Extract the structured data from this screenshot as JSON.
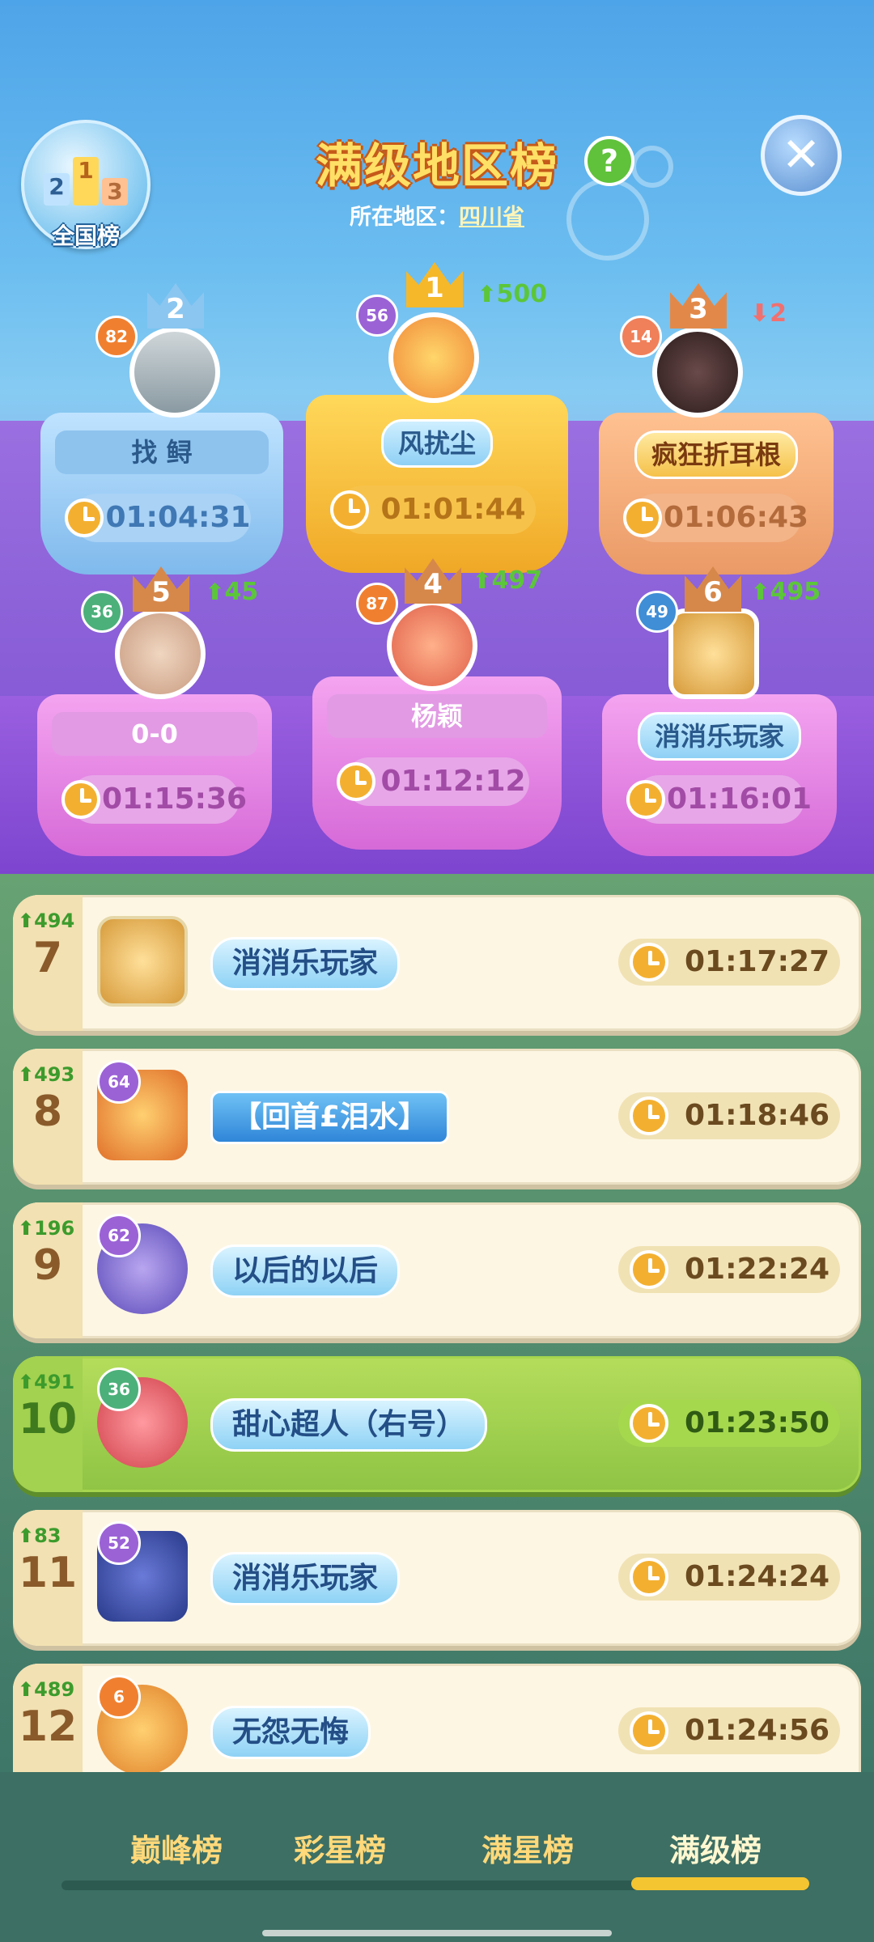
{
  "header": {
    "title": "满级地区榜",
    "national_label": "全国榜",
    "national_bars": [
      "2",
      "1",
      "3"
    ],
    "help_icon": "?",
    "close_icon": "✕",
    "region_label": "所在地区：",
    "region_value": "四川省"
  },
  "podium": [
    {
      "rank": "1",
      "level": "56",
      "change": "500",
      "name": "风扰尘",
      "time": "01:01:44"
    },
    {
      "rank": "2",
      "level": "82",
      "change": "",
      "name": "找 鲟",
      "time": "01:04:31"
    },
    {
      "rank": "3",
      "level": "14",
      "change": "2",
      "name": "疯狂折耳根",
      "time": "01:06:43"
    },
    {
      "rank": "5",
      "level": "36",
      "change": "45",
      "name": "0-0",
      "time": "01:15:36"
    },
    {
      "rank": "4",
      "level": "87",
      "change": "497",
      "name": "杨颖",
      "time": "01:12:12"
    },
    {
      "rank": "6",
      "level": "49",
      "change": "495",
      "name": "消消乐玩家",
      "time": "01:16:01"
    }
  ],
  "rows": [
    {
      "rank": "7",
      "delta": "494",
      "level": "",
      "name": "消消乐玩家",
      "time": "01:17:27"
    },
    {
      "rank": "8",
      "delta": "493",
      "level": "64",
      "name": "【回首£泪水】",
      "time": "01:18:46"
    },
    {
      "rank": "9",
      "delta": "196",
      "level": "62",
      "name": "以后的以后",
      "time": "01:22:24"
    },
    {
      "rank": "10",
      "delta": "491",
      "level": "36",
      "name": "甜心超人（右号）",
      "time": "01:23:50"
    },
    {
      "rank": "11",
      "delta": "83",
      "level": "52",
      "name": "消消乐玩家",
      "time": "01:24:24"
    },
    {
      "rank": "12",
      "delta": "489",
      "level": "6",
      "name": "无怨无悔",
      "time": "01:24:56"
    }
  ],
  "tabs": [
    "巅峰榜",
    "彩星榜",
    "满星榜",
    "满级榜"
  ],
  "colors": {
    "accent": "#f4c531",
    "up": "#5cc63a",
    "down": "#f07070",
    "highlight_row": "#b5dd5c"
  }
}
